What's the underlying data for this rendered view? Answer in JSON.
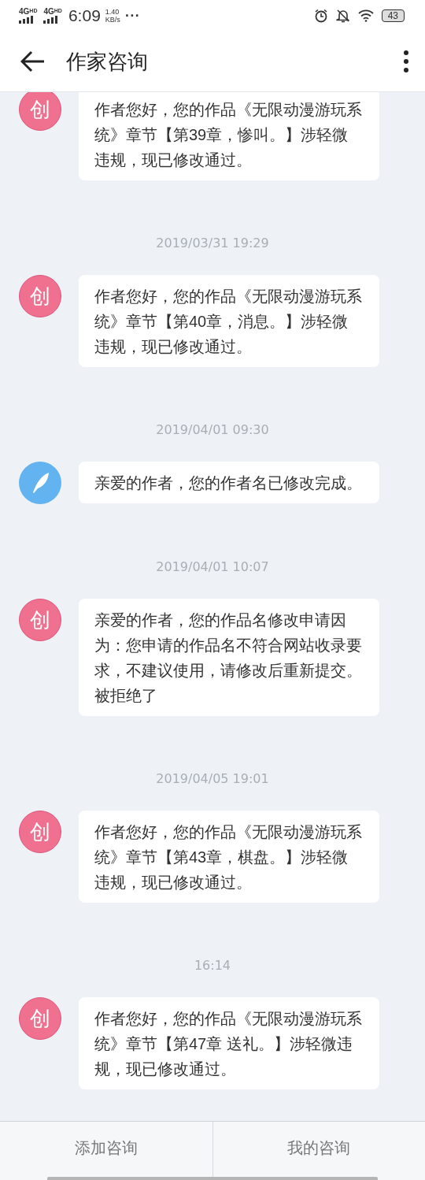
{
  "status_bar": {
    "networks": [
      {
        "label": "4G",
        "sup": "HD"
      },
      {
        "label": "4G",
        "sup": "HD"
      }
    ],
    "time": "6:09",
    "speed_value": "1.40",
    "speed_unit": "KB/s",
    "more": "···",
    "battery": "43"
  },
  "header": {
    "title": "作家咨询"
  },
  "messages": [
    {
      "kind": "creator",
      "avatar_label": "创",
      "text": "作者您好，您的作品《无限动漫游玩系统》章节【第39章，惨叫。】涉轻微违规，现已修改通过。"
    },
    {
      "time": "2019/03/31 19:29",
      "kind": "creator",
      "avatar_label": "创",
      "text": "作者您好，您的作品《无限动漫游玩系统》章节【第40章，消息。】涉轻微违规，现已修改通过。"
    },
    {
      "time": "2019/04/01 09:30",
      "kind": "feather",
      "text": "亲爱的作者，您的作者名已修改完成。"
    },
    {
      "time": "2019/04/01 10:07",
      "kind": "creator",
      "avatar_label": "创",
      "text": "亲爱的作者，您的作品名修改申请因为：您申请的作品名不符合网站收录要求，不建议使用，请修改后重新提交。被拒绝了"
    },
    {
      "time": "2019/04/05 19:01",
      "kind": "creator",
      "avatar_label": "创",
      "text": "作者您好，您的作品《无限动漫游玩系统》章节【第43章，棋盘。】涉轻微违规，现已修改通过。"
    },
    {
      "time": "16:14",
      "kind": "creator",
      "avatar_label": "创",
      "text": "作者您好，您的作品《无限动漫游玩系统》章节【第47章 送礼。】涉轻微违规，现已修改通过。"
    }
  ],
  "footer": {
    "buttons": [
      "添加咨询",
      "我的咨询"
    ]
  }
}
